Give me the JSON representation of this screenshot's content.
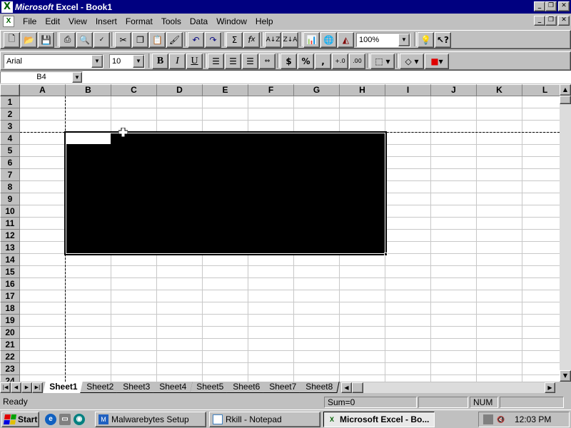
{
  "window": {
    "title_brand": "Microsoft",
    "title_rest": " Excel - Book1",
    "caption_min": "_",
    "caption_restore": "❐",
    "caption_close": "✕"
  },
  "menu": [
    "File",
    "Edit",
    "View",
    "Insert",
    "Format",
    "Tools",
    "Data",
    "Window",
    "Help"
  ],
  "toolbar": {
    "zoom": "100%",
    "font_name": "Arial",
    "font_size": "10",
    "bold": "B",
    "italic": "I",
    "underline": "U",
    "currency": "$",
    "percent": "%",
    "comma": ","
  },
  "formula_bar": {
    "name_box": "B4",
    "formula": ""
  },
  "grid": {
    "columns": [
      "A",
      "B",
      "C",
      "D",
      "E",
      "F",
      "G",
      "H",
      "I",
      "J",
      "K",
      "L"
    ],
    "rows": [
      "1",
      "2",
      "3",
      "4",
      "5",
      "6",
      "7",
      "8",
      "9",
      "10",
      "11",
      "12",
      "13",
      "14",
      "15",
      "16",
      "17",
      "18",
      "19",
      "20",
      "21",
      "22",
      "23",
      "24"
    ],
    "selection": "B4:H13"
  },
  "sheet_tabs": [
    "Sheet1",
    "Sheet2",
    "Sheet3",
    "Sheet4",
    "Sheet5",
    "Sheet6",
    "Sheet7",
    "Sheet8"
  ],
  "active_sheet": "Sheet1",
  "status_bar": {
    "status": "Ready",
    "sum": "Sum=0",
    "num": "NUM"
  },
  "taskbar": {
    "start": "Start",
    "tasks": [
      {
        "label": "Malwarebytes Setup",
        "icon": "setup-icon",
        "active": false
      },
      {
        "label": "Rkill - Notepad",
        "icon": "notepad-icon",
        "active": false
      },
      {
        "label": "Microsoft Excel - Bo...",
        "icon": "excel-icon",
        "active": true
      }
    ],
    "clock": "12:03 PM"
  },
  "colors": {
    "titlebar": "#000080",
    "face": "#c0c0c0",
    "selection": "#000000"
  }
}
